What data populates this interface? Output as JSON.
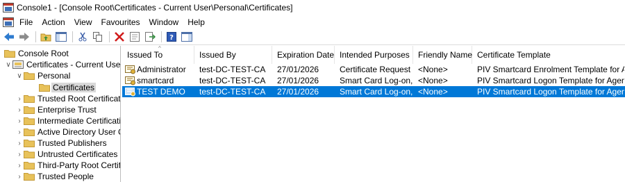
{
  "window": {
    "title": "Console1 - [Console Root\\Certificates - Current User\\Personal\\Certificates]"
  },
  "menu": [
    "File",
    "Action",
    "View",
    "Favourites",
    "Window",
    "Help"
  ],
  "toolbar": [
    "back-icon",
    "forward-icon",
    "up-folder-icon",
    "show-hide-tree-icon",
    "cut-icon",
    "copy-icon",
    "delete-icon",
    "properties-icon",
    "export-icon",
    "help-icon",
    "show-action-pane-icon"
  ],
  "tree": {
    "root": "Console Root",
    "certs_current_user": "Certificates - Current User",
    "personal": "Personal",
    "certificates": "Certificates",
    "items": [
      "Trusted Root Certificatio",
      "Enterprise Trust",
      "Intermediate Certificatio",
      "Active Directory User Ob",
      "Trusted Publishers",
      "Untrusted Certificates",
      "Third-Party Root Certific",
      "Trusted People"
    ]
  },
  "columns": [
    "Issued To",
    "Issued By",
    "Expiration Date",
    "Intended Purposes",
    "Friendly Name",
    "Certificate Template"
  ],
  "rows": [
    [
      "Administrator",
      "test-DC-TEST-CA",
      "27/01/2026",
      "Certificate Request ...",
      "<None>",
      "PIV Smartcard Enrolment Template for Agents"
    ],
    [
      "smartcard",
      "test-DC-TEST-CA",
      "27/01/2026",
      "Smart Card Log-on, ...",
      "<None>",
      "PIV Smartcard Logon Template for Agents"
    ],
    [
      "TEST DEMO",
      "test-DC-TEST-CA",
      "27/01/2026",
      "Smart Card Log-on, ...",
      "<None>",
      "PIV Smartcard Logon Template for Agents"
    ]
  ],
  "selected_row": 2,
  "colors": {
    "selection": "#0078d7",
    "folder": "#e8c25a"
  }
}
